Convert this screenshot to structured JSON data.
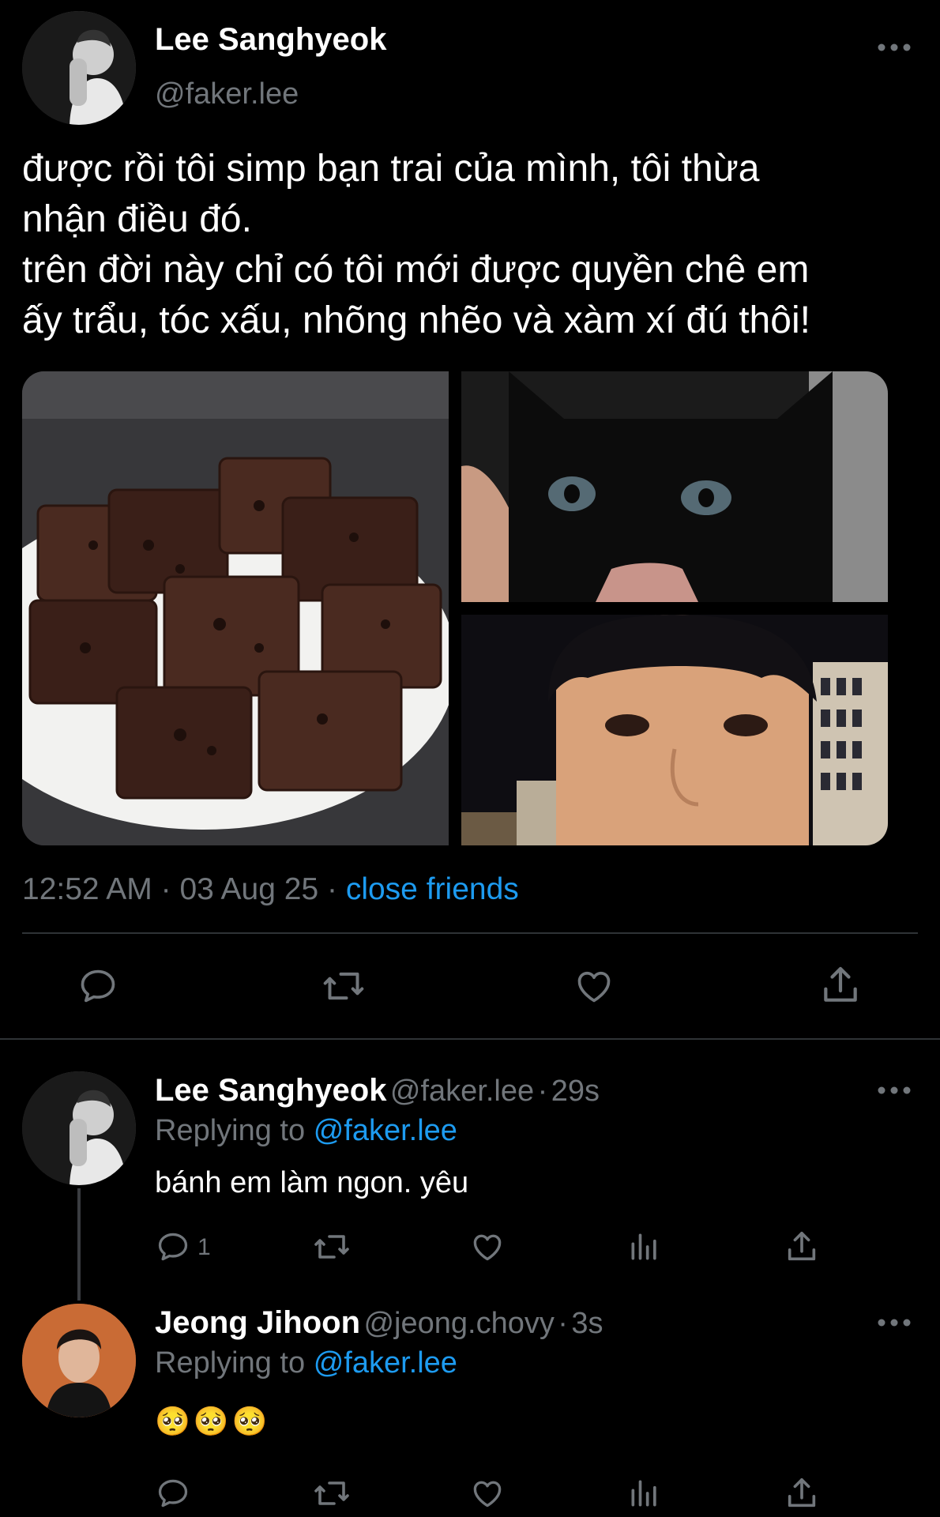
{
  "tweet": {
    "author_name": "Lee Sanghyeok",
    "author_handle": "@faker.lee",
    "text": "được rồi tôi simp bạn trai của mình, tôi thừa\nnhận điều đó.\ntrên đời này chỉ có tôi mới được quyền chê em\nấy trẩu, tóc xấu, nhõng nhẽo và xàm xí đú thôi!",
    "media": [
      {
        "label": "brownies-photo"
      },
      {
        "label": "black-kitten-photo"
      },
      {
        "label": "selfie-photo"
      }
    ],
    "time": "12:52 AM",
    "date": "03 Aug 25",
    "audience": "close friends",
    "sep": "·"
  },
  "replies": [
    {
      "name": "Lee Sanghyeok",
      "handle": "@faker.lee",
      "age": "29s",
      "replying_label": "Replying to",
      "replying_to": "@faker.lee",
      "text": "bánh em làm ngon. yêu",
      "reply_count": "1"
    },
    {
      "name": "Jeong Jihoon",
      "handle": "@jeong.chovy",
      "age": "3s",
      "replying_label": "Replying to",
      "replying_to": "@faker.lee",
      "text": "🥺🥺🥺",
      "reply_count": ""
    }
  ],
  "icons": {
    "more": "more-horizontal-icon",
    "reply": "reply-icon",
    "retweet": "retweet-icon",
    "like": "like-icon",
    "share": "share-icon",
    "analytics": "analytics-icon"
  },
  "colors": {
    "background": "#000000",
    "link": "#1d9bf0",
    "muted": "#71767b",
    "divider": "#2f3336"
  }
}
